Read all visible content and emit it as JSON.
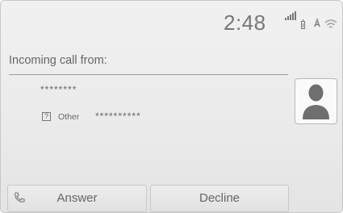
{
  "status": {
    "time": "2:48",
    "icons": [
      "signal-icon",
      "battery-icon",
      "bluetooth-icon",
      "wifi-icon"
    ]
  },
  "call": {
    "header": "Incoming call from:",
    "caller_name": "********",
    "number_type": "Other",
    "number": "**********"
  },
  "buttons": {
    "answer": "Answer",
    "decline": "Decline"
  }
}
